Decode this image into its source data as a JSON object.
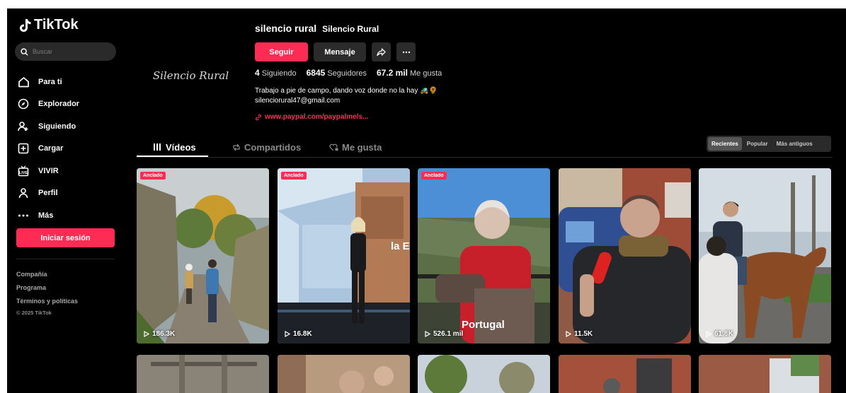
{
  "brand": {
    "name": "TikTok",
    "accent": "#fe2c55"
  },
  "sidebar": {
    "search_placeholder": "Buscar",
    "nav": [
      {
        "label": "Para ti",
        "icon": "home-icon"
      },
      {
        "label": "Explorador",
        "icon": "compass-icon"
      },
      {
        "label": "Siguiendo",
        "icon": "user-plus-icon"
      },
      {
        "label": "Cargar",
        "icon": "upload-icon"
      },
      {
        "label": "VIVIR",
        "icon": "live-tv-icon"
      },
      {
        "label": "Perfil",
        "icon": "profile-icon"
      },
      {
        "label": "Más",
        "icon": "more-dots-icon"
      }
    ],
    "login_label": "Iniciar sesión",
    "footer": [
      "Compañía",
      "Programa",
      "Términos y políticas"
    ],
    "copyright": "© 2025 TikTok"
  },
  "profile": {
    "avatar_text": "Silencio Rural",
    "username": "silencio rural",
    "nickname": "Silencio Rural",
    "follow_label": "Seguir",
    "message_label": "Mensaje",
    "following_count": "4",
    "following_label": "Siguiendo",
    "followers_count": "6845",
    "followers_label": "Seguidores",
    "likes_count": "67.2 mil",
    "likes_label": "Me gusta",
    "bio_line1": "Trabajo a pie de campo, dando voz donde no la hay 🚜🌻",
    "bio_line2": "silenciorural47@gmail.com",
    "link": "www.paypal.com/paypalme/s..."
  },
  "tabs": [
    {
      "label": "Vídeos",
      "icon": "grid-icon"
    },
    {
      "label": "Compartidos",
      "icon": "repost-icon"
    },
    {
      "label": "Me gusta",
      "icon": "heart-lock-icon"
    }
  ],
  "sort_options": [
    "Recientes",
    "Popular",
    "Más antiguos"
  ],
  "videos": [
    {
      "pinned": "Anclado",
      "views": "186.3K"
    },
    {
      "pinned": "Anclado",
      "views": "16.8K",
      "overlay": "la E"
    },
    {
      "pinned": "Anclado",
      "views": "526.1 mil",
      "overlay": "Portugal"
    },
    {
      "views": "11.5K"
    },
    {
      "views": "61.8K"
    }
  ]
}
